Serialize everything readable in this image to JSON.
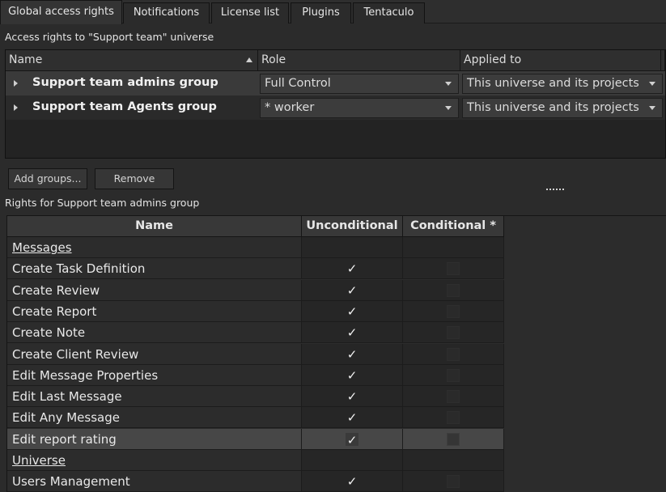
{
  "tabs": [
    {
      "label": "Global access rights",
      "active": true
    },
    {
      "label": "Notifications",
      "active": false
    },
    {
      "label": "License list",
      "active": false
    },
    {
      "label": "Plugins",
      "active": false
    },
    {
      "label": "Tentaculo",
      "active": false
    }
  ],
  "access_caption": "Access rights to \"Support team\" universe",
  "groups_table": {
    "columns": [
      "Name",
      "Role",
      "Applied to"
    ],
    "rows": [
      {
        "name": "Support team admins group",
        "role": "Full Control",
        "applied_to": "This universe and its projects"
      },
      {
        "name": "Support team Agents group",
        "role": "* worker",
        "applied_to": "This universe and its projects"
      }
    ]
  },
  "buttons": {
    "add_groups": "Add groups...",
    "remove": "Remove"
  },
  "rights_caption": "Rights for  Support team admins group",
  "rights_table": {
    "columns": [
      "Name",
      "Unconditional",
      "Conditional *"
    ],
    "check_glyph": "✓",
    "rows": [
      {
        "name": "Messages",
        "category": true
      },
      {
        "name": "Create Task Definition",
        "unconditional": true
      },
      {
        "name": "Create Review",
        "unconditional": true
      },
      {
        "name": "Create Report",
        "unconditional": true
      },
      {
        "name": "Create Note",
        "unconditional": true
      },
      {
        "name": "Create Client Review",
        "unconditional": true
      },
      {
        "name": "Edit Message Properties",
        "unconditional": true
      },
      {
        "name": "Edit Last Message",
        "unconditional": true
      },
      {
        "name": "Edit Any Message",
        "unconditional": true
      },
      {
        "name": "Edit report rating",
        "unconditional": true,
        "selected": true
      },
      {
        "name": "Universe",
        "category": true
      },
      {
        "name": "Users Management",
        "unconditional": true
      }
    ]
  }
}
